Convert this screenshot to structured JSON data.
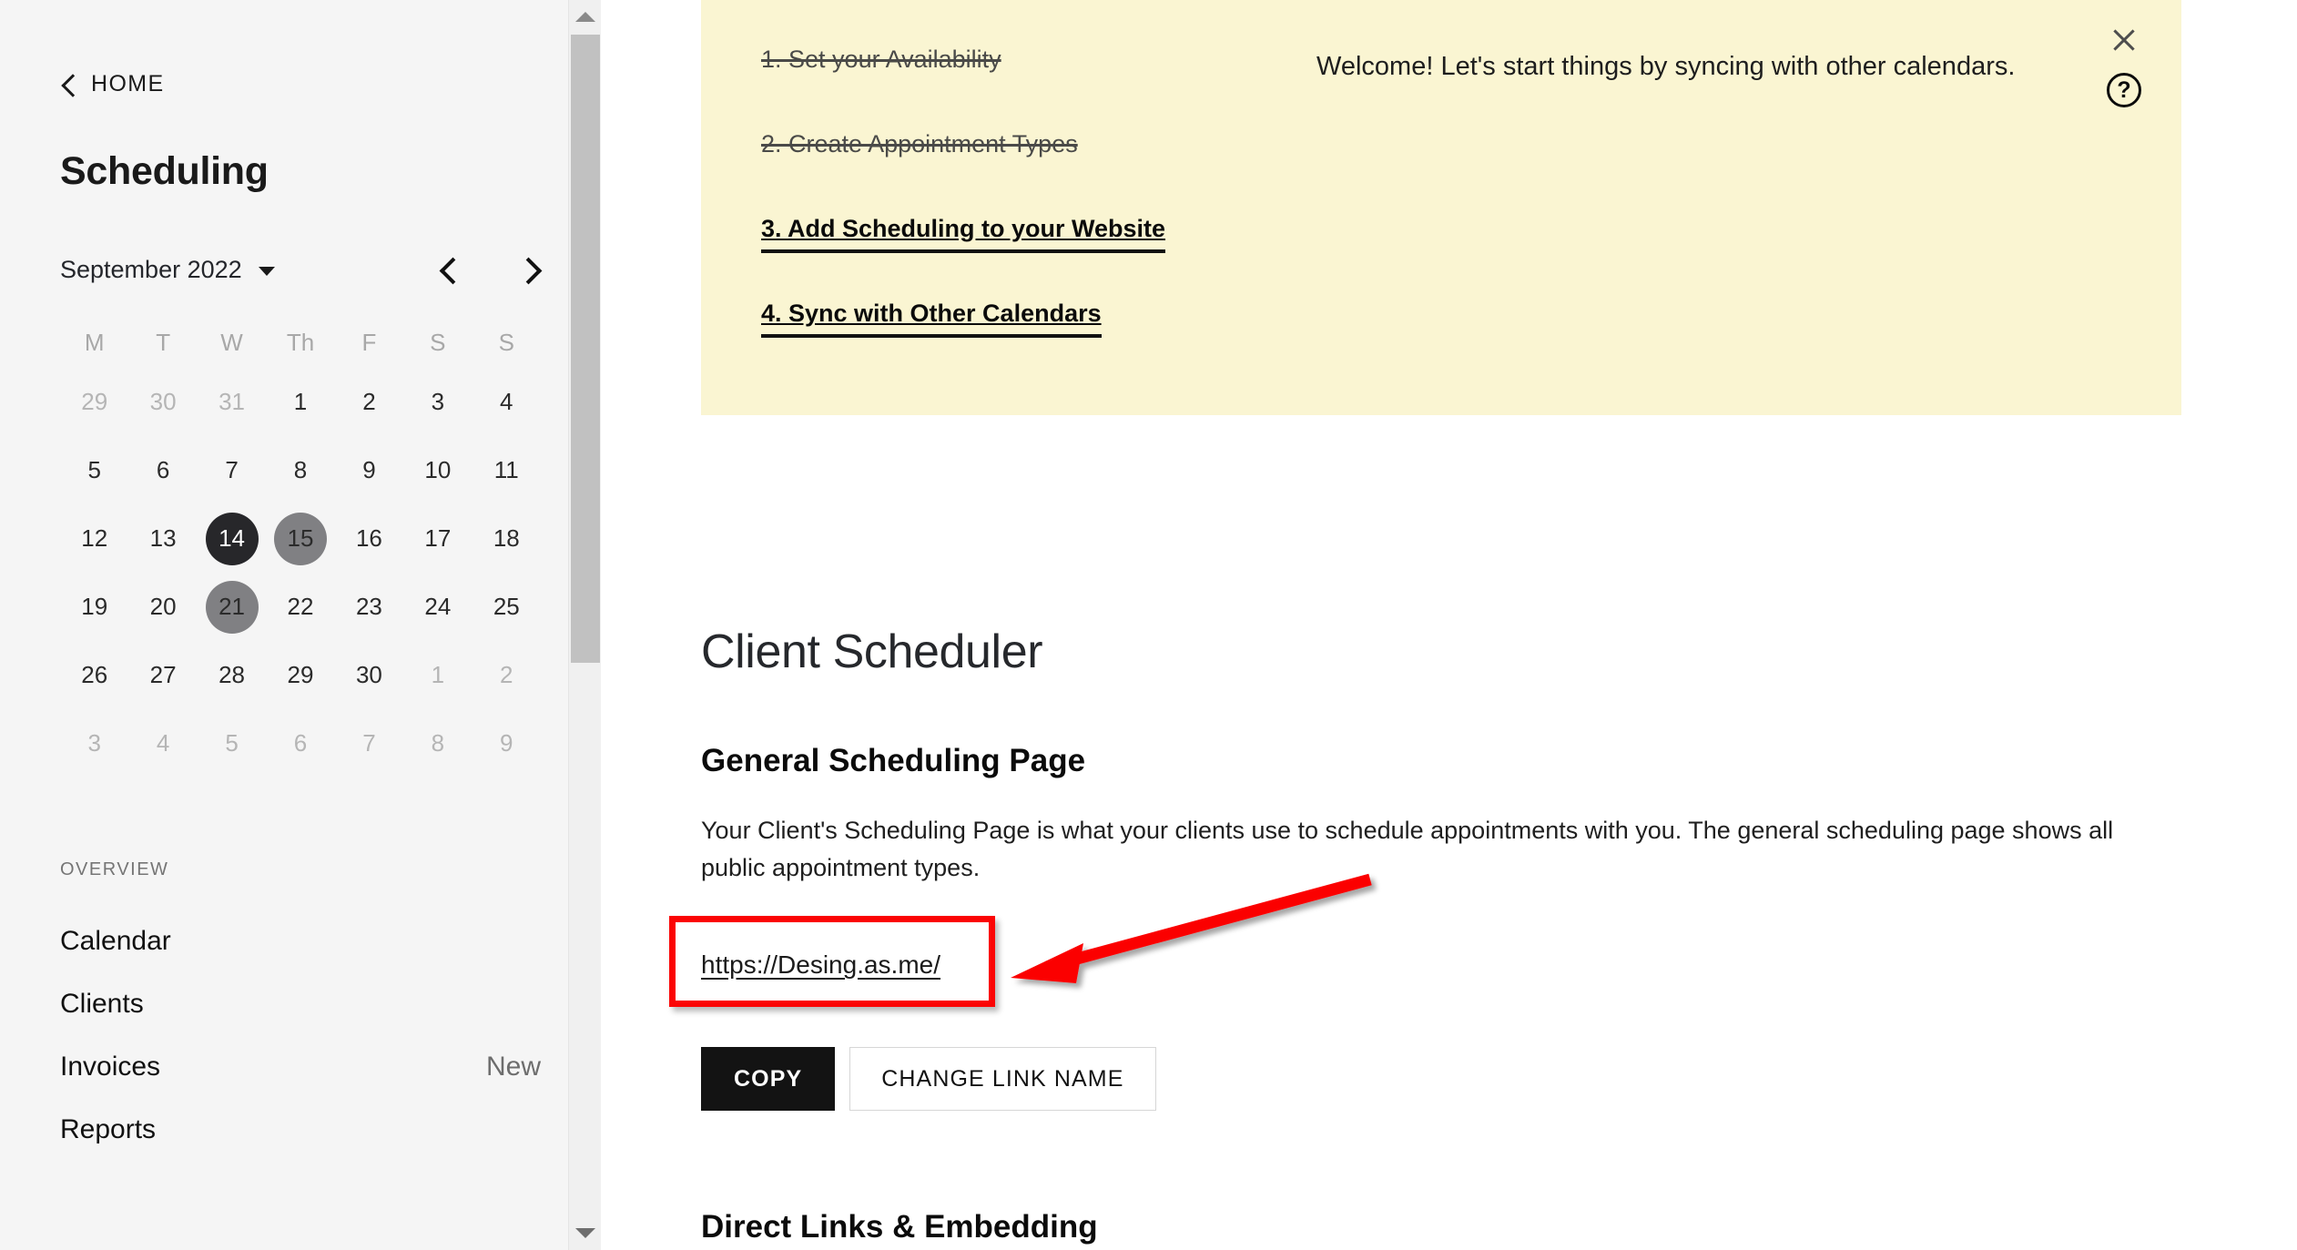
{
  "sidebar": {
    "home_label": "HOME",
    "page_title": "Scheduling",
    "calendar": {
      "month_label": "September 2022",
      "prev_icon": "chevron-left-icon",
      "next_icon": "chevron-right-icon",
      "day_headers": [
        "M",
        "T",
        "W",
        "Th",
        "F",
        "S",
        "S"
      ],
      "weeks": [
        [
          {
            "n": "29",
            "state": "muted"
          },
          {
            "n": "30",
            "state": "muted"
          },
          {
            "n": "31",
            "state": "muted"
          },
          {
            "n": "1",
            "state": "normal"
          },
          {
            "n": "2",
            "state": "normal"
          },
          {
            "n": "3",
            "state": "normal"
          },
          {
            "n": "4",
            "state": "normal"
          }
        ],
        [
          {
            "n": "5",
            "state": "normal"
          },
          {
            "n": "6",
            "state": "normal"
          },
          {
            "n": "7",
            "state": "normal"
          },
          {
            "n": "8",
            "state": "normal"
          },
          {
            "n": "9",
            "state": "normal"
          },
          {
            "n": "10",
            "state": "normal"
          },
          {
            "n": "11",
            "state": "normal"
          }
        ],
        [
          {
            "n": "12",
            "state": "normal"
          },
          {
            "n": "13",
            "state": "normal"
          },
          {
            "n": "14",
            "state": "selected"
          },
          {
            "n": "15",
            "state": "marked"
          },
          {
            "n": "16",
            "state": "normal"
          },
          {
            "n": "17",
            "state": "normal"
          },
          {
            "n": "18",
            "state": "normal"
          }
        ],
        [
          {
            "n": "19",
            "state": "normal"
          },
          {
            "n": "20",
            "state": "normal"
          },
          {
            "n": "21",
            "state": "marked"
          },
          {
            "n": "22",
            "state": "normal"
          },
          {
            "n": "23",
            "state": "normal"
          },
          {
            "n": "24",
            "state": "normal"
          },
          {
            "n": "25",
            "state": "normal"
          }
        ],
        [
          {
            "n": "26",
            "state": "normal"
          },
          {
            "n": "27",
            "state": "normal"
          },
          {
            "n": "28",
            "state": "normal"
          },
          {
            "n": "29",
            "state": "normal"
          },
          {
            "n": "30",
            "state": "normal"
          },
          {
            "n": "1",
            "state": "muted"
          },
          {
            "n": "2",
            "state": "muted"
          }
        ],
        [
          {
            "n": "3",
            "state": "muted"
          },
          {
            "n": "4",
            "state": "muted"
          },
          {
            "n": "5",
            "state": "muted"
          },
          {
            "n": "6",
            "state": "muted"
          },
          {
            "n": "7",
            "state": "muted"
          },
          {
            "n": "8",
            "state": "muted"
          },
          {
            "n": "9",
            "state": "muted"
          }
        ]
      ]
    },
    "overview_label": "OVERVIEW",
    "nav_items": [
      {
        "label": "Calendar",
        "badge": ""
      },
      {
        "label": "Clients",
        "badge": ""
      },
      {
        "label": "Invoices",
        "badge": "New"
      },
      {
        "label": "Reports",
        "badge": ""
      }
    ]
  },
  "banner": {
    "background_color": "#faf5d2",
    "steps": [
      {
        "label": "1. Set your Availability",
        "state": "done"
      },
      {
        "label": "2. Create Appointment Types",
        "state": "done"
      },
      {
        "label": "3. Add Scheduling to your Website",
        "state": "active"
      },
      {
        "label": "4. Sync with Other Calendars",
        "state": "active"
      }
    ],
    "message": "Welcome! Let's start things by syncing with other calendars.",
    "close_icon": "close-icon",
    "help_icon": "help-icon",
    "help_glyph": "?"
  },
  "main": {
    "title": "Client Scheduler",
    "general_section": {
      "heading": "General Scheduling Page",
      "body": "Your Client's Scheduling Page is what your clients use to schedule appointments with you. The general scheduling page shows all public appointment types.",
      "link": "https://Desing.as.me/",
      "copy_button": "COPY",
      "change_button": "CHANGE LINK NAME"
    },
    "direct_links_heading": "Direct Links & Embedding"
  },
  "annotation": {
    "highlight_color": "#fb0505",
    "arrow_color": "#fb0505"
  }
}
